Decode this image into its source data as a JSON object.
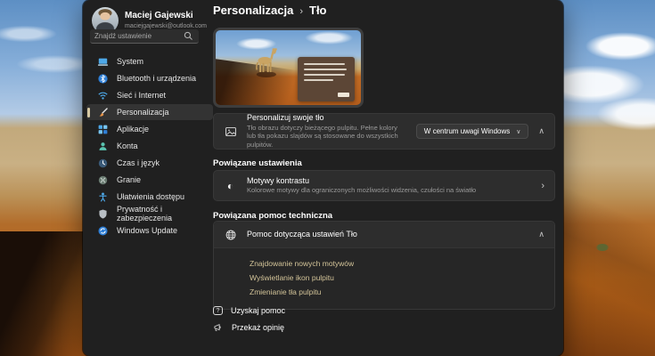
{
  "colors": {
    "accent_link": "#d2c398",
    "window_bg": "#202020",
    "card_bg": "#2d2d2d",
    "accent_pill": "#d6c8a2"
  },
  "profile": {
    "name": "Maciej Gajewski",
    "email": "maciejgajewski@outlook.com"
  },
  "search": {
    "placeholder": "Znajdź ustawienie"
  },
  "sidebar": {
    "items": [
      {
        "label": "System",
        "icon": "system-icon"
      },
      {
        "label": "Bluetooth i urządzenia",
        "icon": "bluetooth-icon"
      },
      {
        "label": "Sieć i Internet",
        "icon": "network-icon"
      },
      {
        "label": "Personalizacja",
        "icon": "personalization-icon",
        "selected": true
      },
      {
        "label": "Aplikacje",
        "icon": "apps-icon"
      },
      {
        "label": "Konta",
        "icon": "accounts-icon"
      },
      {
        "label": "Czas i język",
        "icon": "time-language-icon"
      },
      {
        "label": "Granie",
        "icon": "gaming-icon"
      },
      {
        "label": "Ułatwienia dostępu",
        "icon": "accessibility-icon"
      },
      {
        "label": "Prywatność i zabezpieczenia",
        "icon": "privacy-icon"
      },
      {
        "label": "Windows Update",
        "icon": "windows-update-icon"
      }
    ]
  },
  "header": {
    "breadcrumb_parent": "Personalizacja",
    "separator": "›",
    "title": "Tło"
  },
  "background_section": {
    "title": "Personalizuj swoje tło",
    "description": "Tło obrazu dotyczy bieżącego pulpitu. Pełne kolory lub tła pokazu slajdów są stosowane do wszystkich pulpitów.",
    "dropdown_value": "W centrum uwagi Windows"
  },
  "related_settings": {
    "heading": "Powiązane ustawienia",
    "contrast_card": {
      "title": "Motywy kontrastu",
      "description": "Kolorowe motywy dla ograniczonych możliwości widzenia, czułości na światło"
    }
  },
  "support_section": {
    "heading": "Powiązana pomoc techniczna",
    "card_title": "Pomoc dotycząca ustawień Tło",
    "links": [
      "Znajdowanie nowych motywów",
      "Wyświetlanie ikon pulpitu",
      "Zmienianie tła pulpitu"
    ]
  },
  "footer": {
    "get_help": "Uzyskaj pomoc",
    "feedback": "Przekaż opinię",
    "help_glyph": "?"
  },
  "glyphs": {
    "chevron_down": "∨",
    "chevron_up": "∧",
    "chevron_right": "›",
    "contrast": "◐"
  }
}
